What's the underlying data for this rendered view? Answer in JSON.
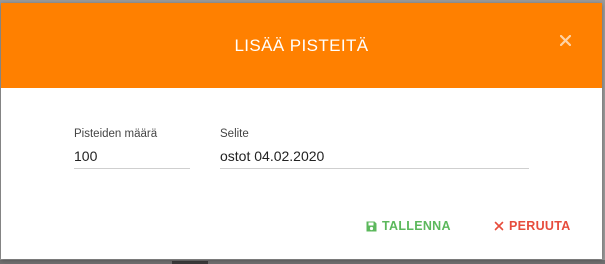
{
  "dialog": {
    "title": "LISÄÄ PISTEITÄ",
    "close_icon": "close-icon",
    "header_color": "#ff8000"
  },
  "form": {
    "points": {
      "label": "Pisteiden määrä",
      "value": "100"
    },
    "description": {
      "label": "Selite",
      "value": "ostot 04.02.2020"
    }
  },
  "actions": {
    "save": {
      "label": "TALLENNA",
      "icon": "floppy-disk-icon",
      "color": "#5cb85c"
    },
    "cancel": {
      "label": "PERUUTA",
      "icon": "close-x-icon",
      "color": "#e74c3c"
    }
  }
}
